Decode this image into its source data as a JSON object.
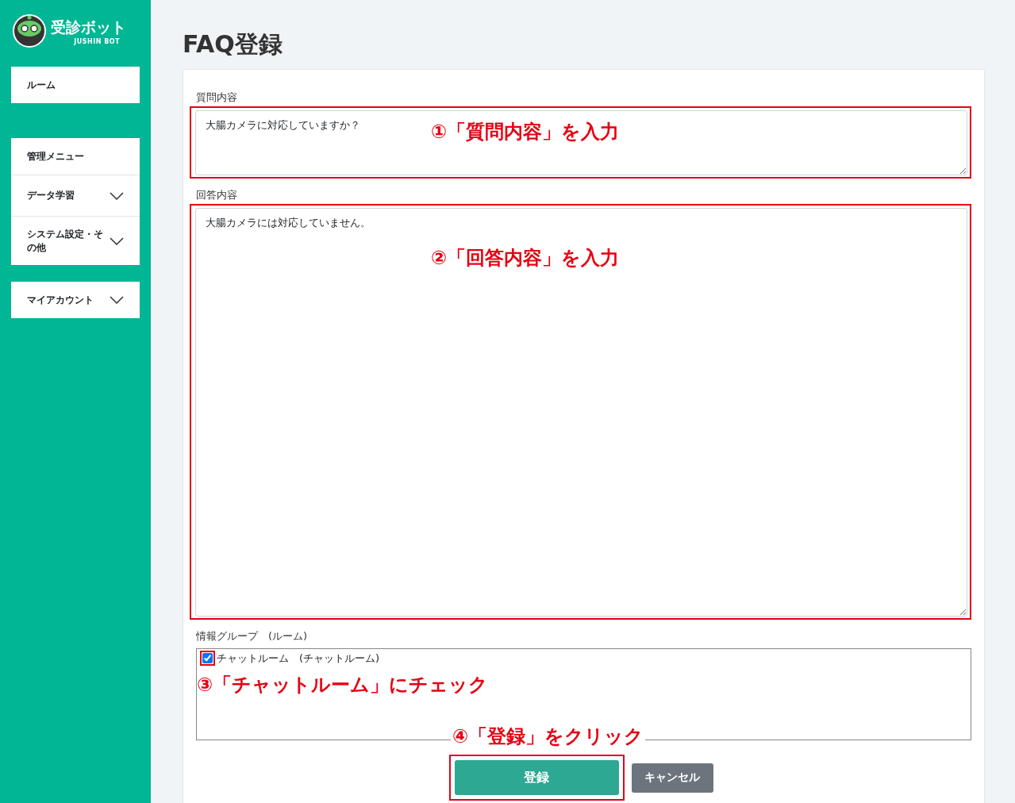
{
  "logo": {
    "title": "受診ボット",
    "subtitle": "JUSHIN BOT"
  },
  "sidebar": {
    "groups": [
      {
        "items": [
          {
            "label": "ルーム",
            "expandable": false
          }
        ]
      },
      {
        "items": [
          {
            "label": "管理メニュー",
            "expandable": false
          },
          {
            "label": "データ学習",
            "expandable": true
          },
          {
            "label": "システム設定・その他",
            "expandable": true
          }
        ]
      },
      {
        "items": [
          {
            "label": "マイアカウント",
            "expandable": true
          }
        ]
      }
    ]
  },
  "page": {
    "title": "FAQ登録"
  },
  "form": {
    "question": {
      "label": "質問内容",
      "value": "大腸カメラに対応していますか？",
      "annotation": "①「質問内容」を入力"
    },
    "answer": {
      "label": "回答内容",
      "value": "大腸カメラには対応していません。",
      "annotation": "②「回答内容」を入力"
    },
    "group": {
      "label": "情報グループ　(ルーム)",
      "options": [
        {
          "label": "チャットルーム　(チャットルーム)",
          "checked": true,
          "highlighted": true
        }
      ],
      "annotation": "③「チャットルーム」にチェック"
    },
    "buttons_annotation": "④「登録」をクリック",
    "buttons": [
      {
        "label": "登録",
        "kind": "primary",
        "highlighted": true
      },
      {
        "label": "キャンセル",
        "kind": "secondary",
        "highlighted": false
      }
    ]
  }
}
